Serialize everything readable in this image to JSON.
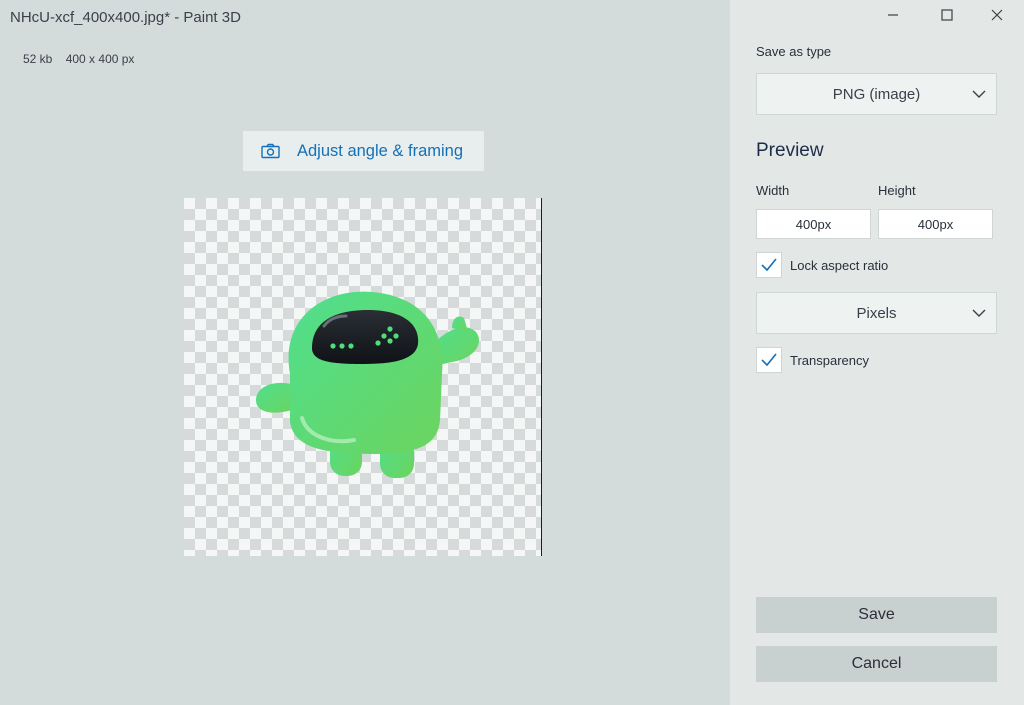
{
  "window": {
    "title": "NHcU-xcf_400x400.jpg* - Paint 3D",
    "file_size": "52 kb",
    "dimensions": "400 x 400 px"
  },
  "workspace": {
    "adjust_button_label": "Adjust angle & framing",
    "canvas_background": "transparent-checkerboard",
    "image_subject": "green robot mascot"
  },
  "colors": {
    "accent_blue": "#1470b8",
    "panel_bg": "#e3e8e7",
    "workspace_bg": "#d4dcdb",
    "button_bg": "#c9d1d0",
    "check_blue": "#1470b8",
    "robot_green": "#5ed87a"
  },
  "icons": {
    "adjust": "camera-icon",
    "minimize": "minimize-icon",
    "maximize": "maximize-icon",
    "close": "close-icon",
    "dropdown": "chevron-down-icon",
    "check": "checkmark-icon"
  },
  "panel": {
    "save_as_type_label": "Save as type",
    "save_as_type_value": "PNG (image)",
    "preview_heading": "Preview",
    "width_label": "Width",
    "height_label": "Height",
    "width_value": "400px",
    "height_value": "400px",
    "lock_aspect_label": "Lock aspect ratio",
    "lock_aspect_checked": true,
    "units_value": "Pixels",
    "transparency_label": "Transparency",
    "transparency_checked": true,
    "save_label": "Save",
    "cancel_label": "Cancel"
  }
}
